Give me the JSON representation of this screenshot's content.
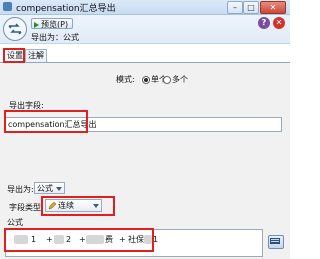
{
  "window": {
    "title": "compensation汇总导出"
  },
  "toolbar": {
    "preview_label": "预览(P)",
    "subtitle": "导出为：公式"
  },
  "tabs": [
    {
      "label": "设置"
    },
    {
      "label": "注解"
    }
  ],
  "mode": {
    "label": "模式:",
    "options": [
      {
        "label": "单个",
        "selected": true
      },
      {
        "label": "多个",
        "selected": false
      }
    ]
  },
  "derive_field": {
    "label": "导出字段:",
    "value": "compensation汇总导出"
  },
  "derive_as": {
    "label": "导出为:",
    "value": "公式"
  },
  "field_type": {
    "label": "字段类型:",
    "value": "连续"
  },
  "formula": {
    "label": "公式",
    "visible_fragments": [
      "1",
      "+",
      "2",
      "+",
      "费",
      "+",
      "社保",
      "1"
    ]
  },
  "colors": {
    "highlight": "#e02020",
    "accent": "#4a7fb8"
  },
  "icons": [
    "app-icon",
    "derive-node-icon",
    "play-icon",
    "help-icon",
    "close-icon",
    "pencil-icon",
    "expression-builder-icon"
  ]
}
